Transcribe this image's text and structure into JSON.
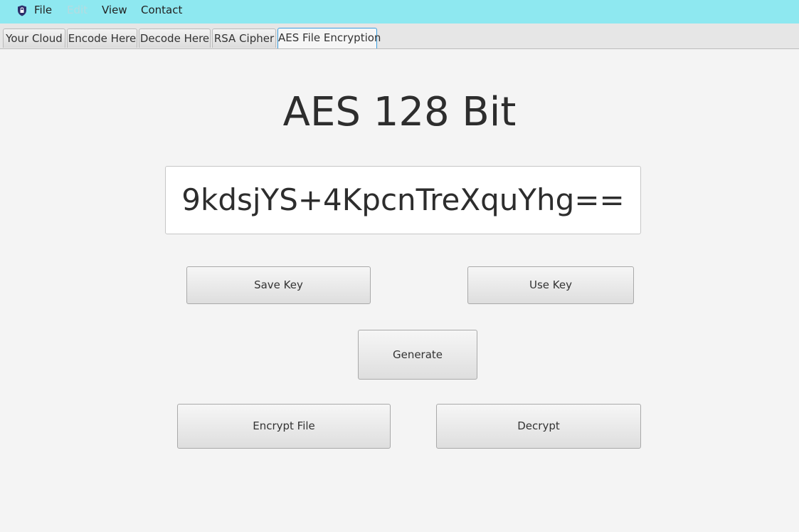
{
  "menubar": {
    "icon": "shield-lock-icon",
    "background": "#8ee8f0",
    "items": [
      {
        "label": "File",
        "enabled": true
      },
      {
        "label": "Edit",
        "enabled": false
      },
      {
        "label": "View",
        "enabled": true
      },
      {
        "label": "Contact",
        "enabled": true
      }
    ]
  },
  "tabs": [
    {
      "label": "Your Cloud",
      "selected": false
    },
    {
      "label": "Encode Here",
      "selected": false
    },
    {
      "label": "Decode Here",
      "selected": false
    },
    {
      "label": "RSA Cipher",
      "selected": false
    },
    {
      "label": "AES File Encryption",
      "selected": true
    }
  ],
  "main": {
    "title": "AES 128 Bit",
    "key_value": "9kdsjYS+4KpcnTreXquYhg==",
    "buttons": {
      "save_key": "Save Key",
      "use_key": "Use Key",
      "generate": "Generate",
      "encrypt_file": "Encrypt File",
      "decrypt": "Decrypt"
    }
  },
  "colors": {
    "selected_tab_border": "#3c9fe0",
    "disabled_menu_text": "#b6dbe0"
  }
}
